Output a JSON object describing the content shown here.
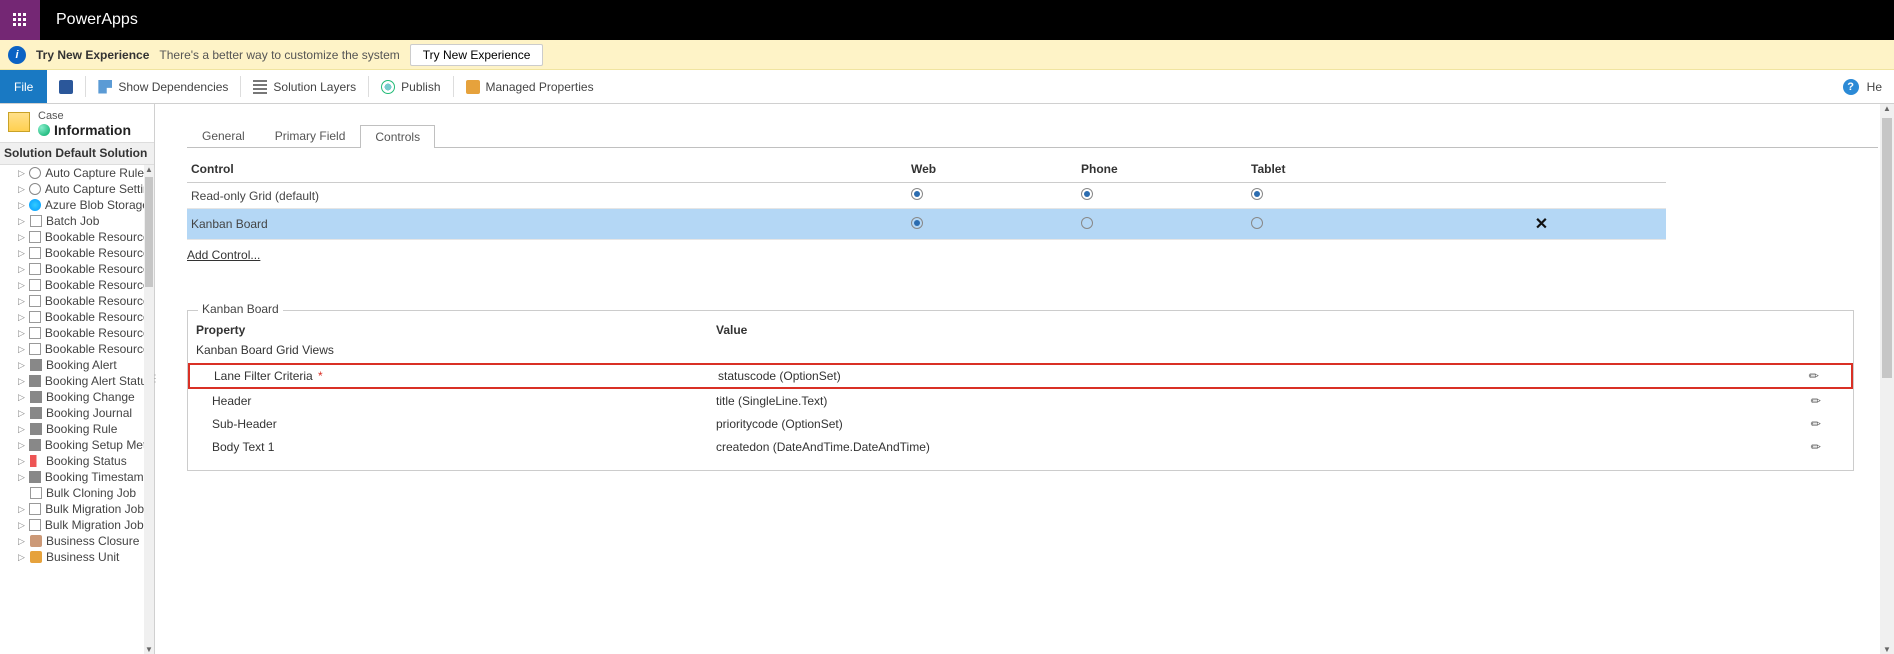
{
  "globalNav": {
    "brand": "PowerApps"
  },
  "notification": {
    "title": "Try New Experience",
    "message": "There's a better way to customize the system",
    "button": "Try New Experience"
  },
  "ribbon": {
    "file": "File",
    "deps": "Show Dependencies",
    "layers": "Solution Layers",
    "publish": "Publish",
    "managed": "Managed Properties",
    "help": "He"
  },
  "leftRail": {
    "entityLabel": "Case",
    "pageTitle": "Information",
    "solution": "Solution Default Solution",
    "tree": [
      {
        "label": "Auto Capture Rule",
        "iconClass": "gear",
        "caret": "▷"
      },
      {
        "label": "Auto Capture Settin...",
        "iconClass": "gear",
        "caret": "▷"
      },
      {
        "label": "Azure Blob Storage ...",
        "iconClass": "cloud",
        "caret": "▷"
      },
      {
        "label": "Batch Job",
        "iconClass": "page",
        "caret": "▷"
      },
      {
        "label": "Bookable Resource",
        "iconClass": "page",
        "caret": "▷"
      },
      {
        "label": "Bookable Resource ...",
        "iconClass": "page",
        "caret": "▷"
      },
      {
        "label": "Bookable Resource ...",
        "iconClass": "page",
        "caret": "▷"
      },
      {
        "label": "Bookable Resource ...",
        "iconClass": "page",
        "caret": "▷"
      },
      {
        "label": "Bookable Resource ...",
        "iconClass": "page",
        "caret": "▷"
      },
      {
        "label": "Bookable Resource ...",
        "iconClass": "page",
        "caret": "▷"
      },
      {
        "label": "Bookable Resource ...",
        "iconClass": "page",
        "caret": "▷"
      },
      {
        "label": "Bookable Resource ...",
        "iconClass": "page",
        "caret": "▷"
      },
      {
        "label": "Booking Alert",
        "iconClass": "grid",
        "caret": "▷"
      },
      {
        "label": "Booking Alert Status",
        "iconClass": "grid",
        "caret": "▷"
      },
      {
        "label": "Booking Change",
        "iconClass": "grid",
        "caret": "▷"
      },
      {
        "label": "Booking Journal",
        "iconClass": "grid",
        "caret": "▷"
      },
      {
        "label": "Booking Rule",
        "iconClass": "grid",
        "caret": "▷"
      },
      {
        "label": "Booking Setup Met...",
        "iconClass": "grid",
        "caret": "▷"
      },
      {
        "label": "Booking Status",
        "iconClass": "flag",
        "caret": "▷"
      },
      {
        "label": "Booking Timestamp",
        "iconClass": "grid",
        "caret": "▷"
      },
      {
        "label": "Bulk Cloning Job",
        "iconClass": "page",
        "caret": ""
      },
      {
        "label": "Bulk Migration Job",
        "iconClass": "page",
        "caret": "▷"
      },
      {
        "label": "Bulk Migration Job ...",
        "iconClass": "page",
        "caret": "▷"
      },
      {
        "label": "Business Closure",
        "iconClass": "group",
        "caret": "▷"
      },
      {
        "label": "Business Unit",
        "iconClass": "orange",
        "caret": "▷"
      }
    ]
  },
  "tabs": {
    "general": "General",
    "primary": "Primary Field",
    "controls": "Controls"
  },
  "controlTable": {
    "headers": {
      "control": "Control",
      "web": "Web",
      "phone": "Phone",
      "tablet": "Tablet"
    },
    "rows": [
      {
        "name": "Read-only Grid (default)",
        "web": true,
        "phone": true,
        "tablet": true,
        "removable": false,
        "selected": false
      },
      {
        "name": "Kanban Board",
        "web": true,
        "phone": false,
        "tablet": false,
        "removable": true,
        "selected": true
      }
    ],
    "addControl": "Add Control..."
  },
  "kanban": {
    "legend": "Kanban Board",
    "propertyHeader": "Property",
    "valueHeader": "Value",
    "subheading": "Kanban Board Grid Views",
    "rows": [
      {
        "label": "Lane Filter Criteria",
        "required": true,
        "value": "statuscode (OptionSet)",
        "highlight": true
      },
      {
        "label": "Header",
        "required": false,
        "value": "title (SingleLine.Text)",
        "highlight": false
      },
      {
        "label": "Sub-Header",
        "required": false,
        "value": "prioritycode (OptionSet)",
        "highlight": false
      },
      {
        "label": "Body Text 1",
        "required": false,
        "value": "createdon (DateAndTime.DateAndTime)",
        "highlight": false
      }
    ]
  }
}
